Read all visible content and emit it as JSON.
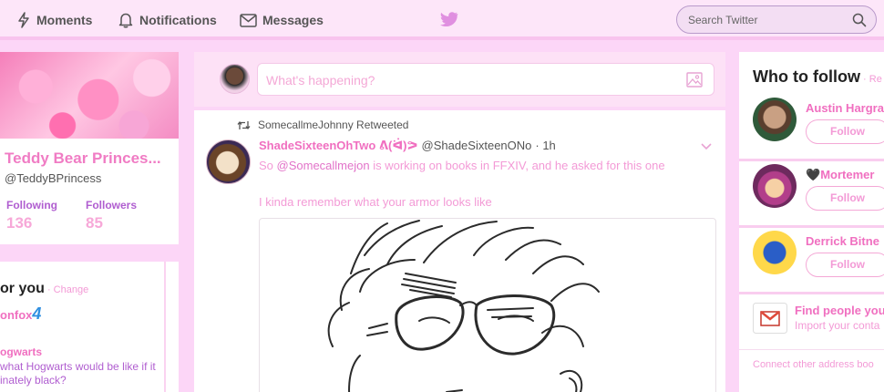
{
  "nav": {
    "moments": "Moments",
    "notifications": "Notifications",
    "messages": "Messages",
    "bird_icon": "twitter-bird-icon",
    "search_placeholder": "Search Twitter"
  },
  "profile": {
    "name": "Teddy Bear Princes...",
    "handle": "@TeddyBPrincess",
    "following_label": "Following",
    "following_value": "136",
    "followers_label": "Followers",
    "followers_value": "85"
  },
  "trends": {
    "title": "or you",
    "separator": " · ",
    "change": "Change",
    "trend1": "onfox",
    "trend1_suffix": "4",
    "trend2_title": "ogwarts",
    "trend2_desc": "what Hogwarts would be like if it inately black?"
  },
  "compose": {
    "placeholder": "What's happening?"
  },
  "tweet": {
    "retweeted_by": "SomecallmeJohnny Retweeted",
    "author": "ShadeSixteenOhTwo ᕕ(ᐛ)ᕗ",
    "handle": "@ShadeSixteenONo",
    "time": "· 1h",
    "text_prefix": "So ",
    "mention": "@Somecallmejon",
    "text_suffix": " is working on books in FFXIV, and he asked for this one",
    "text_line2": "I kinda remember what your armor looks like"
  },
  "who_to_follow": {
    "title": "Who to follow",
    "separator": " · ",
    "refresh": "Re",
    "users": [
      {
        "name": "Austin Hargra",
        "button": "Follow"
      },
      {
        "name": "Mortemer",
        "prefix": "🖤",
        "button": "Follow"
      },
      {
        "name": "Derrick Bitne",
        "button": "Follow"
      }
    ],
    "find_title": "Find people you",
    "find_sub": "Import your conta",
    "connect": "Connect other address boo"
  },
  "colors": {
    "background": "#fcd6f7",
    "accent_pink": "#f06fc0",
    "link_purple": "#b05ed0",
    "light_pink_text": "#f39ad6"
  }
}
